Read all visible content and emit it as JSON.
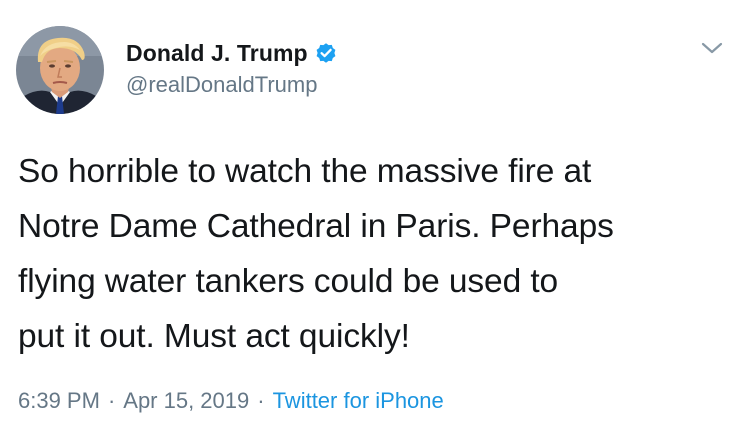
{
  "tweet": {
    "author": {
      "display_name": "Donald J. Trump",
      "handle": "@realDonaldTrump",
      "verified_icon": "verified-badge-icon",
      "avatar_icon": "profile-photo"
    },
    "text": "So horrible to watch the massive fire at\nNotre Dame Cathedral in Paris. Perhaps\nflying water tankers could be used to\nput it out. Must act quickly!",
    "meta": {
      "time": "6:39 PM",
      "separator": "·",
      "date": "Apr 15, 2019",
      "source": "Twitter for iPhone"
    },
    "menu_icon": "chevron-down-icon"
  },
  "colors": {
    "text": "#14171a",
    "secondary": "#657786",
    "link": "#1b95e0",
    "verified": "#1da1f2"
  }
}
